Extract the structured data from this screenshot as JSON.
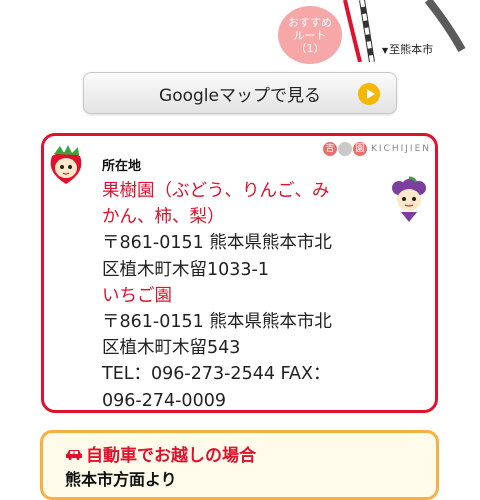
{
  "map": {
    "route_badge": [
      "おすすめ",
      "ルート",
      "（1）"
    ],
    "destination_arrow": "▼",
    "destination": "至熊本市"
  },
  "google_button": {
    "label": "Googleマップで見る",
    "accent": "#f4b800"
  },
  "address_card": {
    "logo_marks": [
      "吉",
      "園"
    ],
    "logo_text": "KICHIJIEN",
    "heading": "所在地",
    "orchard_name_line1": "果樹園（ぶどう、りんご、み",
    "orchard_name_line2": "かん、柿、梨）",
    "orchard_address_line1": "〒861-0151 熊本県熊本市北",
    "orchard_address_line2": "区植木町木留1033-1",
    "strawberry_name": "いちご園",
    "strawberry_address_line1": "〒861-0151 熊本県熊本市北",
    "strawberry_address_line2": "区植木町木留543",
    "tel_line1": "TEL：096-273-2544 FAX：",
    "tel_line2": "096-274-0009",
    "border_color": "#e0112c"
  },
  "car_section": {
    "icon": "car-icon",
    "title": "自動車でお越しの場合",
    "subtitle": "熊本市方面より",
    "border_color": "#f5b041"
  }
}
